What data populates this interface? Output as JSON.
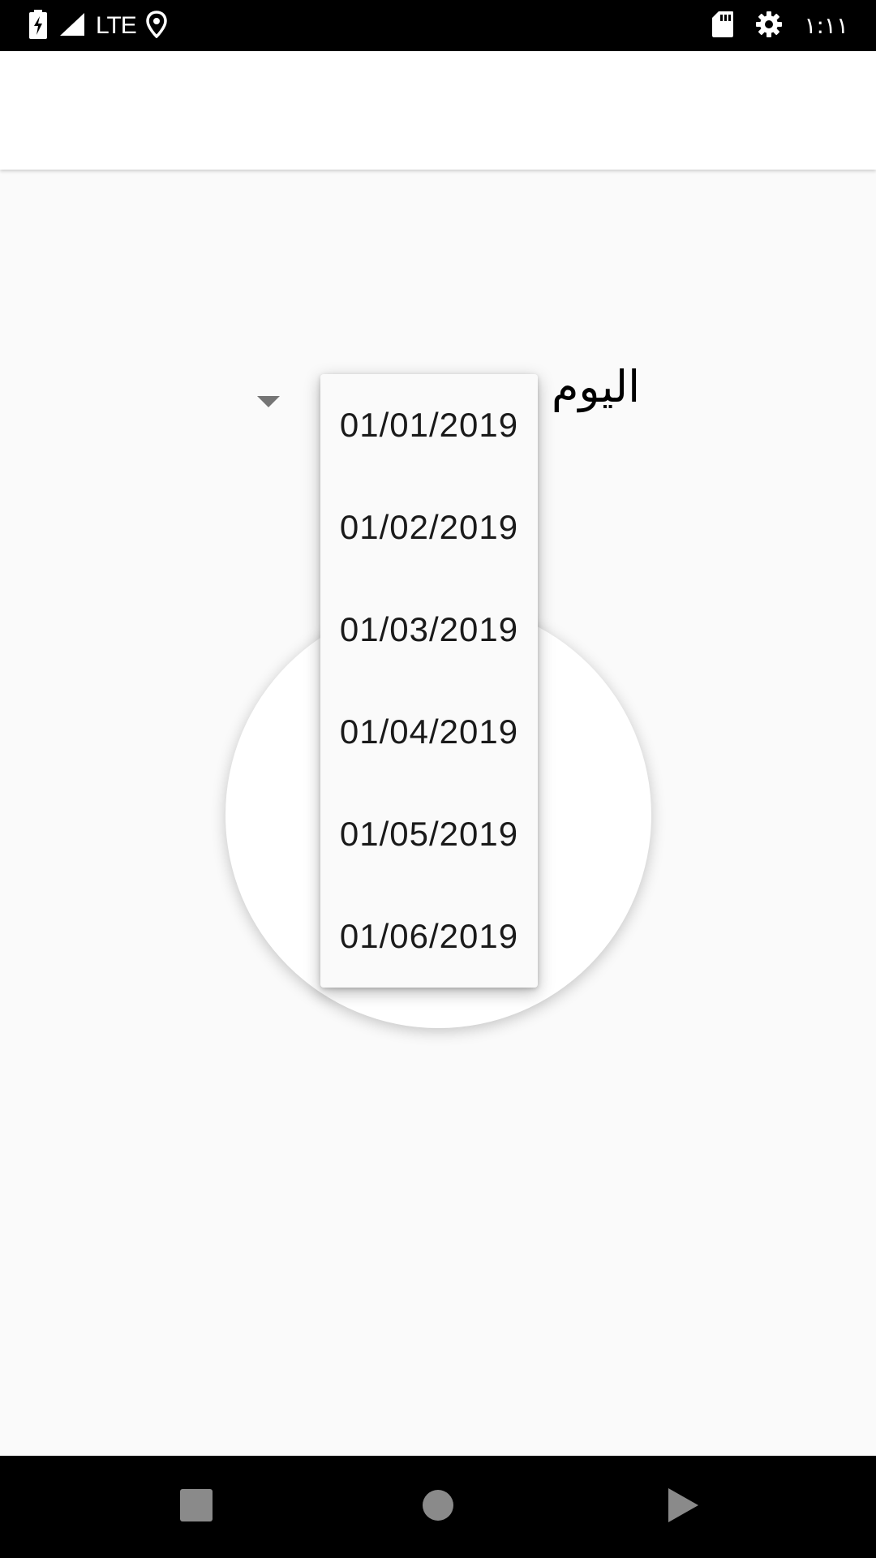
{
  "status_bar": {
    "network": "LTE",
    "time": "١:١١",
    "icons": [
      "battery-charging-icon",
      "signal-icon",
      "location-icon",
      "sd-card-icon",
      "settings-icon"
    ]
  },
  "app_bar": {},
  "form": {
    "day_label": "اليوم"
  },
  "dropdown": {
    "options": [
      "01/01/2019",
      "01/02/2019",
      "01/03/2019",
      "01/04/2019",
      "01/05/2019",
      "01/06/2019"
    ]
  },
  "nav_bar": {
    "icons": [
      "recents-icon",
      "home-icon",
      "back-icon"
    ]
  },
  "colors": {
    "status_bar_bg": "#000000",
    "background": "#fafafa",
    "app_bar_bg": "#ffffff",
    "spinner_arrow": "#757575"
  }
}
